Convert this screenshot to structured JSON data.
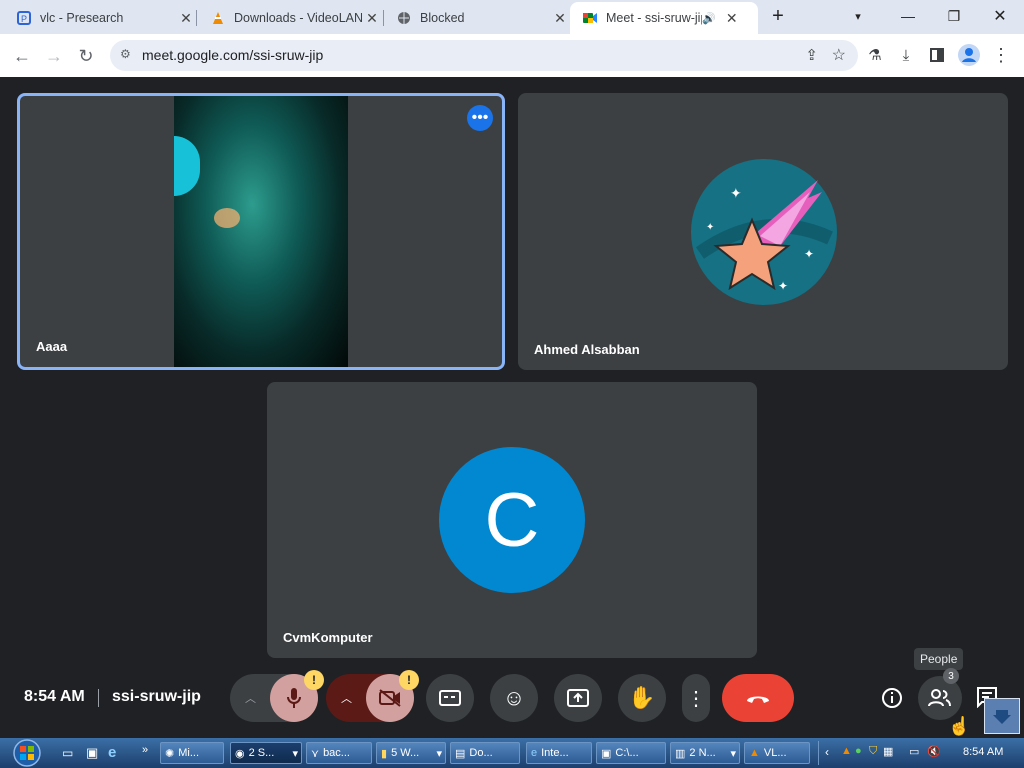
{
  "browser": {
    "tabs": [
      {
        "title": "vlc - Presearch",
        "icon": "presearch-icon"
      },
      {
        "title": "Downloads - VideoLAN",
        "icon": "vlc-cone-icon"
      },
      {
        "title": "Blocked",
        "icon": "globe-icon"
      },
      {
        "title": "Meet - ssi-sruw-jip",
        "icon": "google-meet-icon",
        "active": true
      }
    ],
    "url": "meet.google.com/ssi-sruw-jip"
  },
  "meet": {
    "participants": [
      {
        "name": "Aaaa",
        "type": "video",
        "speaking": true
      },
      {
        "name": "Ahmed Alsabban",
        "type": "avatar"
      },
      {
        "name": "CvmKomputer",
        "type": "initial",
        "initial": "C",
        "color": "#0288d1"
      }
    ],
    "time": "8:54 AM",
    "meeting_code": "ssi-sruw-jip",
    "people_tooltip": "People",
    "people_count": "3",
    "warning_glyph": "!"
  },
  "taskbar": {
    "buttons": [
      {
        "label": "Mi..."
      },
      {
        "label": "2 S..."
      },
      {
        "label": "bac..."
      },
      {
        "label": "5 W..."
      },
      {
        "label": "Do..."
      },
      {
        "label": "Inte..."
      },
      {
        "label": "C:\\..."
      },
      {
        "label": "2 N..."
      },
      {
        "label": "VL..."
      }
    ],
    "clock": "8:54 AM"
  },
  "colors": {
    "end_call": "#ea4335",
    "highlight": "#8ab4f8",
    "muted_red": "#5c1a16"
  }
}
